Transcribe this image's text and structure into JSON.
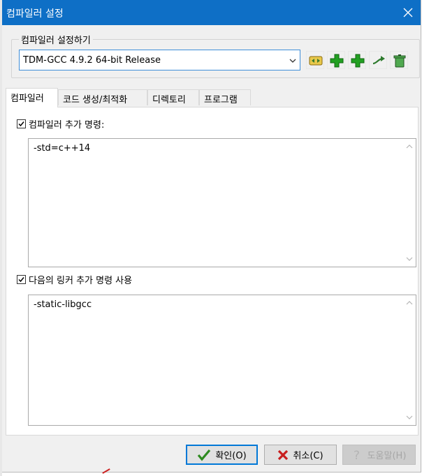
{
  "window": {
    "title": "컴파일러 설정"
  },
  "compiler_set": {
    "group_label": "컴파일러 설정하기",
    "selected": "TDM-GCC 4.9.2 64-bit Release",
    "toolbar": [
      "find-compilers-icon",
      "add-blank-icon",
      "add-new-icon",
      "rename-icon",
      "delete-icon"
    ]
  },
  "tabs": [
    {
      "label": "컴파일러",
      "active": true
    },
    {
      "label": "코드 생성/최적화",
      "active": false
    },
    {
      "label": "디렉토리",
      "active": false
    },
    {
      "label": "프로그램",
      "active": false
    }
  ],
  "compiler_tab": {
    "compile_option": {
      "label": "컴파일러 추가 명령:",
      "checked": true,
      "value": "-std=c++14"
    },
    "linker_option": {
      "label": "다음의 링커 추가 명령 사용",
      "checked": true,
      "value": "-static-libgcc"
    }
  },
  "buttons": {
    "ok": "확인(O)",
    "cancel": "취소(C)",
    "help": "도움말(H)"
  },
  "colors": {
    "titlebar": "#0e6fc6",
    "accent": "#0078d7",
    "ok_check": "#2d8a1f",
    "cancel_x": "#c81e1e",
    "plus_green": "#22a022"
  }
}
